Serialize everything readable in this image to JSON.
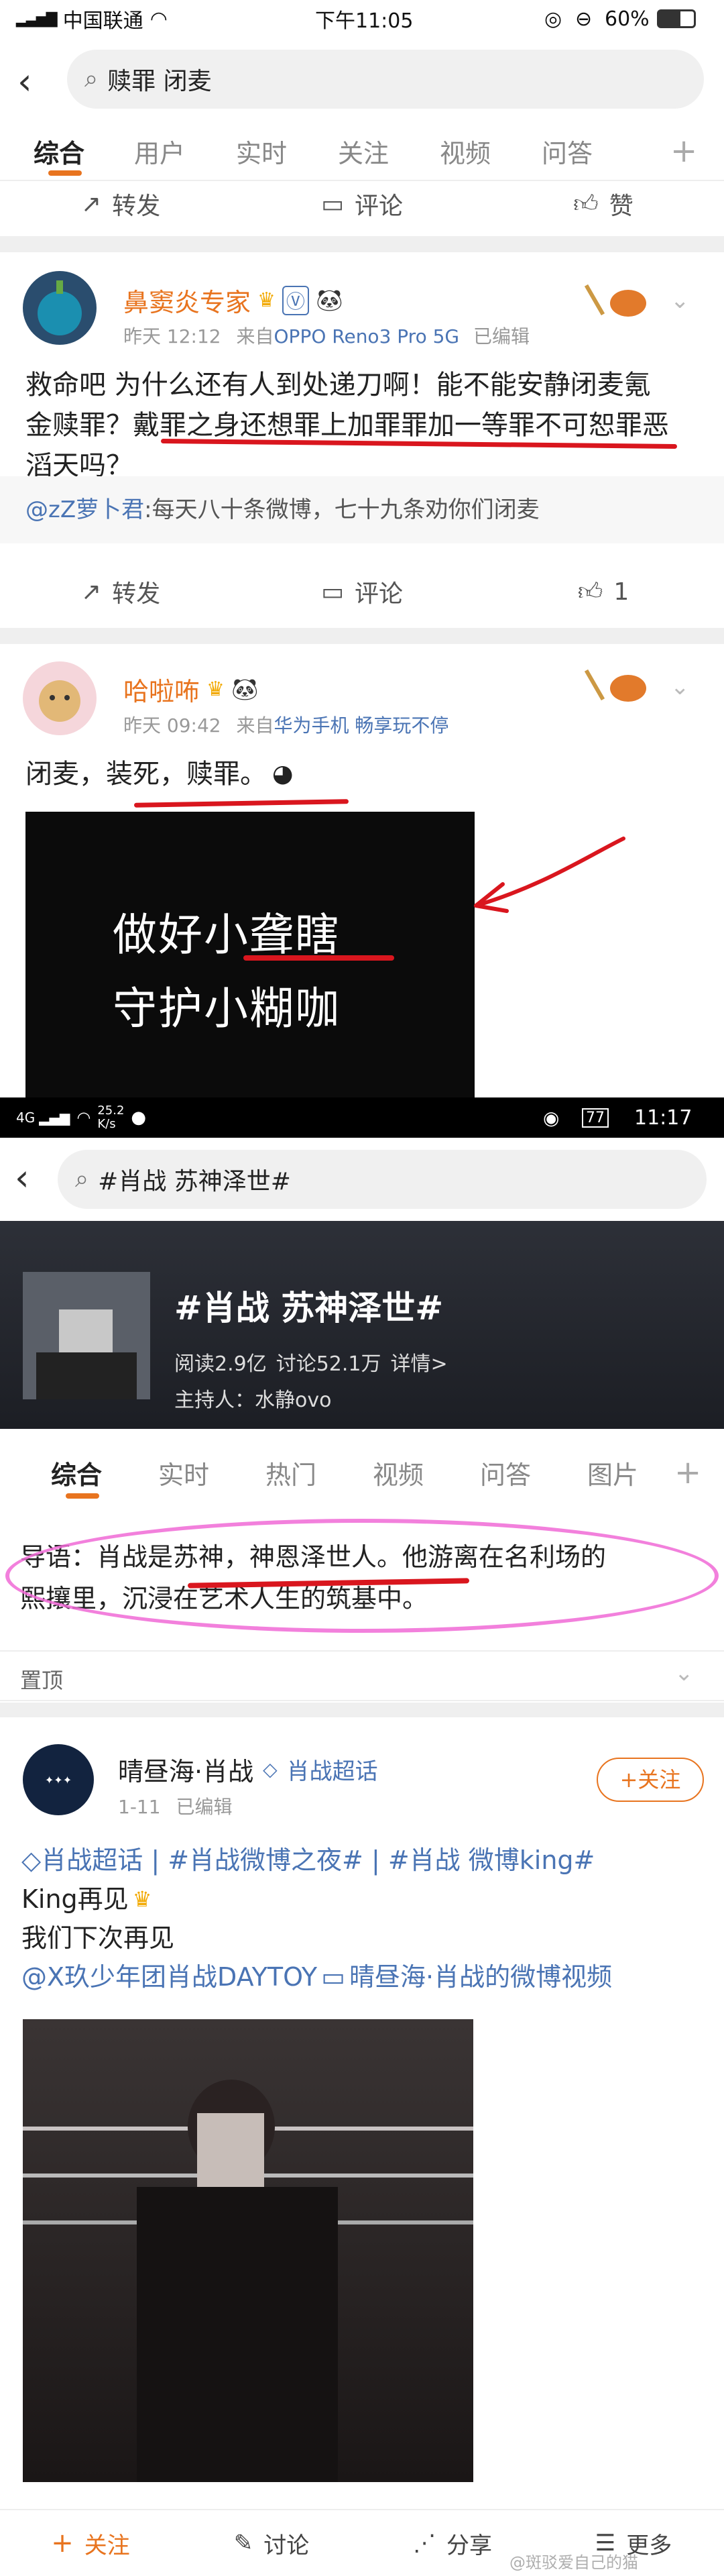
{
  "status1": {
    "carrier": "中国联通",
    "time": "下午11:05",
    "battery": "60%"
  },
  "search1": {
    "query": "赎罪 闭麦"
  },
  "tabs1": [
    "综合",
    "用户",
    "实时",
    "关注",
    "视频",
    "问答"
  ],
  "actions_top": {
    "repost": "转发",
    "comment": "评论",
    "like": "赞"
  },
  "post1": {
    "user": "鼻窦炎专家",
    "time": "昨天 12:12",
    "source_prefix": "来自",
    "device": "OPPO Reno3 Pro 5G",
    "edited": "已编辑",
    "line1": "救命吧 为什么还有人到处递刀啊！能不能安静闭麦氪",
    "line2": "金赎罪？戴罪之身还想罪上加罪罪加一等罪不可恕罪恶",
    "line3": "滔天吗？",
    "comment_user": "@zZ萝卜君",
    "comment_text": ":每天八十条微博，七十九条劝你们闭麦",
    "repost": "转发",
    "comment": "评论",
    "likes": "1"
  },
  "post2": {
    "user": "哈啦咘",
    "time": "昨天 09:42",
    "source_prefix": "来自",
    "device": "华为手机 畅享玩不停",
    "text": "闭麦，装死，赎罪。",
    "image_line1": "做好小聋瞎",
    "image_line2": "守护小糊咖"
  },
  "status2": {
    "signal": "4G",
    "speed": "25.2",
    "speed_unit": "K/s",
    "battery": "77",
    "time": "11:17"
  },
  "search2": {
    "query": "#肖战 苏神泽世#"
  },
  "topic": {
    "title": "#肖战 苏神泽世#",
    "reads": "阅读2.9亿",
    "discuss": "讨论52.1万",
    "detail": "详情>",
    "host": "主持人：水静ovo"
  },
  "tabs2": [
    "综合",
    "实时",
    "热门",
    "视频",
    "问答",
    "图片"
  ],
  "intro": {
    "line1": "导语：肖战是苏神，神恩泽世人。他游离在名利场的",
    "line2": "熙攘里，沉浸在艺术人生的筑基中。"
  },
  "pinned": "置顶",
  "post3": {
    "user": "晴昼海·肖战",
    "badge": "肖战超话",
    "time": "1-11",
    "edited": "已编辑",
    "follow": "+关注",
    "tags": "肖战超话 | #肖战微博之夜# | #肖战 微博king#",
    "line1": "King再见",
    "line2": "我们下次再见",
    "line3a": "@X玖少年团肖战DAYTOY",
    "line3b": "晴昼海·肖战的微博视频"
  },
  "bottombar": {
    "follow": "关注",
    "discuss": "讨论",
    "share": "分享",
    "more": "更多"
  },
  "watermark": "@斑驳爱自己的猫",
  "colors": {
    "accent": "#e8741f",
    "link": "#4a74b4",
    "underline": "#d9161e"
  }
}
